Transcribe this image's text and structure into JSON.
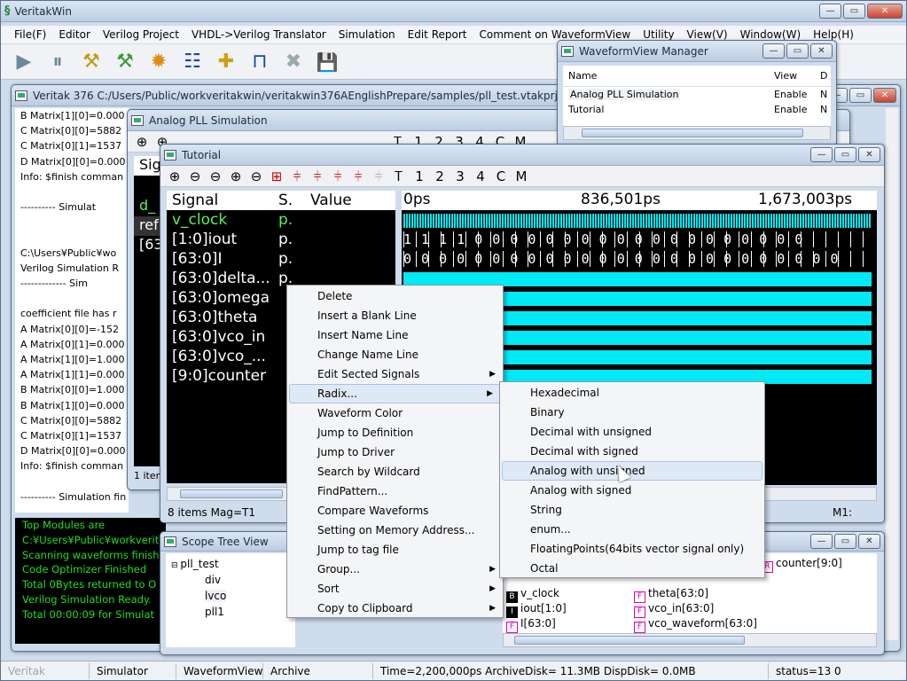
{
  "app": {
    "title": "VeritakWin"
  },
  "menu": [
    "File(F)",
    "Editor",
    "Verilog Project",
    "VHDL->Verilog Translator",
    "Simulation",
    "Edit Report",
    "Comment on WaveformView",
    "Utility",
    "View(V)",
    "Window(W)",
    "Help(H)"
  ],
  "toolbar": {
    "icons": [
      "play-icon",
      "pause-icon",
      "compile-icon",
      "compile-run-icon",
      "settings-gear-icon",
      "hierarchy-icon",
      "add-module-icon",
      "waveform-icon",
      "stop-icon",
      "save-icon"
    ],
    "glyphs": [
      "▶",
      "⏸",
      "⚒",
      "⚒",
      "✹",
      "☷",
      "✚",
      "⊓",
      "✖",
      "💾"
    ]
  },
  "project_window": {
    "title": "Veritak 376 C:/Users/Public/workveritakwin/veritakwin376AEnglishPrepare/samples/pll_test.vtakprj",
    "log_lines": [
      "B Matrix[1][0]=0.000",
      "C Matrix[0][0]=5882",
      "C Matrix[0][1]=1537",
      "D Matrix[0][0]=0.000",
      "Info: $finish comman",
      "",
      "---------- Simulat",
      "",
      "",
      "C:\\Users¥Public¥wo",
      "Verilog Simulation R",
      "------------- Sim",
      "",
      "coefficient file has r",
      "A Matrix[0][0]=-152",
      "A Matrix[0][1]=0.000",
      "A Matrix[1][0]=1.000",
      "A Matrix[1][1]=0.000",
      "B Matrix[0][0]=1.000",
      "B Matrix[1][0]=0.000",
      "C Matrix[0][0]=5882",
      "C Matrix[0][1]=1537",
      "D Matrix[0][0]=0.000",
      "Info: $finish comman",
      "",
      "---------- Simulation fin"
    ],
    "console_lines": [
      "Top Modules are",
      "C:¥Users¥Public¥workverit",
      "Scanning waveforms finishe",
      "Code Optimizer Finished",
      "Total 0Bytes returned to O",
      "Verilog Simulation Ready.",
      "Total  00:00:09 for Simulat"
    ]
  },
  "analog_window": {
    "title": "Analog PLL Simulation",
    "toolbar_glyphs": [
      "Ꭲ",
      "1",
      "2",
      "3",
      "4",
      "C",
      "M"
    ],
    "partial_labels": [
      "Sig",
      "d_",
      "ref",
      "[63:"
    ],
    "count_label": "1 item"
  },
  "tutorial_window": {
    "title": "Tutorial",
    "toolbar_glyphs": [
      "Ꭲ",
      "1",
      "2",
      "3",
      "4",
      "C",
      "M"
    ],
    "columns": {
      "signal": "Signal",
      "s": "S.",
      "value": "Value"
    },
    "signals": [
      {
        "name": "v_clock",
        "s": "p."
      },
      {
        "name": "[1:0]iout",
        "s": "p."
      },
      {
        "name": "[63:0]I",
        "s": "p."
      },
      {
        "name": "[63:0]delta...",
        "s": "p."
      },
      {
        "name": "[63:0]omega",
        "s": ""
      },
      {
        "name": "[63:0]theta",
        "s": ""
      },
      {
        "name": "[63:0]vco_in",
        "s": ""
      },
      {
        "name": "[63:0]vco_...",
        "s": ""
      },
      {
        "name": "[9:0]counter",
        "s": ""
      }
    ],
    "ruler": [
      "0ps",
      "836,501ps",
      "1,673,003ps"
    ],
    "iout_bits": "1 1 1 1   0 0 0 0 0 0 0 0 0 0 0 0 0 0 0 0 0 0 0",
    "I_bits": "0 0 0 0 0 0 0 0 0 0 0 0 0 0 0 0 0 0 0 0 0 0 0 0 0",
    "status": "8 items  Mag=T1",
    "status_right": "M1:"
  },
  "waveform_manager": {
    "title": "WaveformView Manager",
    "columns": [
      "Name",
      "View",
      "D"
    ],
    "rows": [
      {
        "name": "Analog PLL Simulation",
        "view": "Enable",
        "d": "N"
      },
      {
        "name": "Tutorial",
        "view": "Enable",
        "d": "N"
      }
    ]
  },
  "scope_tree": {
    "title": "Scope Tree View",
    "tree": [
      "pll_test",
      "div",
      "lvco",
      "pll1"
    ],
    "signals": [
      {
        "badge": "R",
        "label": "counter[9:0]"
      },
      {
        "badge": "B",
        "label": "v_clock"
      },
      {
        "badge": "I",
        "label": "iout[1:0]"
      },
      {
        "badge": "F",
        "label": "I[63:0]"
      },
      {
        "badge": "F",
        "label": "theta[63:0]"
      },
      {
        "badge": "F",
        "label": "vco_in[63:0]"
      },
      {
        "badge": "F",
        "label": "vco_waveform[63:0]"
      }
    ]
  },
  "context_menu": {
    "items": [
      "Delete",
      "Insert a Blank Line",
      "Insert Name Line",
      "Change Name Line",
      "Edit Sected Signals",
      "Radix...",
      "Waveform Color",
      "Jump to Definition",
      "Jump to Driver",
      "Search by Wildcard",
      "FindPattern...",
      "Compare Waveforms",
      "Setting on Memory Address...",
      "Jump to tag file",
      "Group...",
      "Sort",
      "Copy to Clipboard"
    ]
  },
  "radix_menu": {
    "items": [
      "Hexadecimal",
      "Binary",
      "Decimal with unsigned",
      "Decimal with signed",
      "Analog with unsigned",
      "Analog with signed",
      "String",
      "enum...",
      "FloatingPoints(64bits vector signal only)",
      "Octal"
    ]
  },
  "statusbar": {
    "cells": [
      "Veritak",
      "Simulator",
      "WaveformView",
      "Archive",
      "Time=2,200,000ps ArchiveDisk= 11.3MB DispDisk=  0.0MB",
      "status=13 0"
    ]
  },
  "colors": {
    "wave_fill": "#00eaf5",
    "console_text": "#22dd22",
    "selected_signal": "#5cf15c"
  }
}
